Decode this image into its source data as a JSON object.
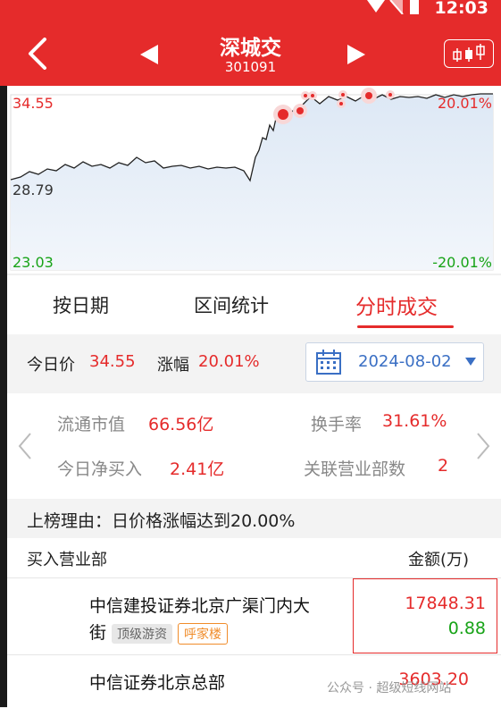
{
  "status": {
    "time": "12:03"
  },
  "header": {
    "title": "深城交",
    "code": "301091"
  },
  "chart": {
    "price_high": "34.55",
    "price_mid": "28.79",
    "price_low": "23.03",
    "pct_high": "20.01%",
    "pct_low": "-20.01%"
  },
  "tabs": [
    "按日期",
    "区间统计",
    "分时成交"
  ],
  "price_bar": {
    "today_price_label": "今日价",
    "today_price": "34.55",
    "change_label": "涨幅",
    "change": "20.01%",
    "date": "2024-08-02"
  },
  "stats": {
    "float_cap_label": "流通市值",
    "float_cap": "66.56亿",
    "turnover_label": "换手率",
    "turnover": "31.61%",
    "net_buy_label": "今日净买入",
    "net_buy": "2.41亿",
    "dept_count_label": "关联营业部数",
    "dept_count": "2"
  },
  "reason": "上榜理由：日价格涨幅达到20.00%",
  "list_header": {
    "left": "买入营业部",
    "right": "金额(万)"
  },
  "rows": [
    {
      "name_line1": "中信建投证券北京广渠门内大",
      "name_line2": "街",
      "tag1": "顶级游资",
      "tag2": "呼家楼",
      "amount": "17848.31",
      "sub_amount": "0.88"
    },
    {
      "name_line1": "中信证券北京总部",
      "amount": "3603.20"
    }
  ],
  "watermark": "公众号 · 超级短线网站",
  "colors": {
    "accent": "#e52b2b",
    "up": "#e52b2b",
    "down": "#17a317"
  }
}
